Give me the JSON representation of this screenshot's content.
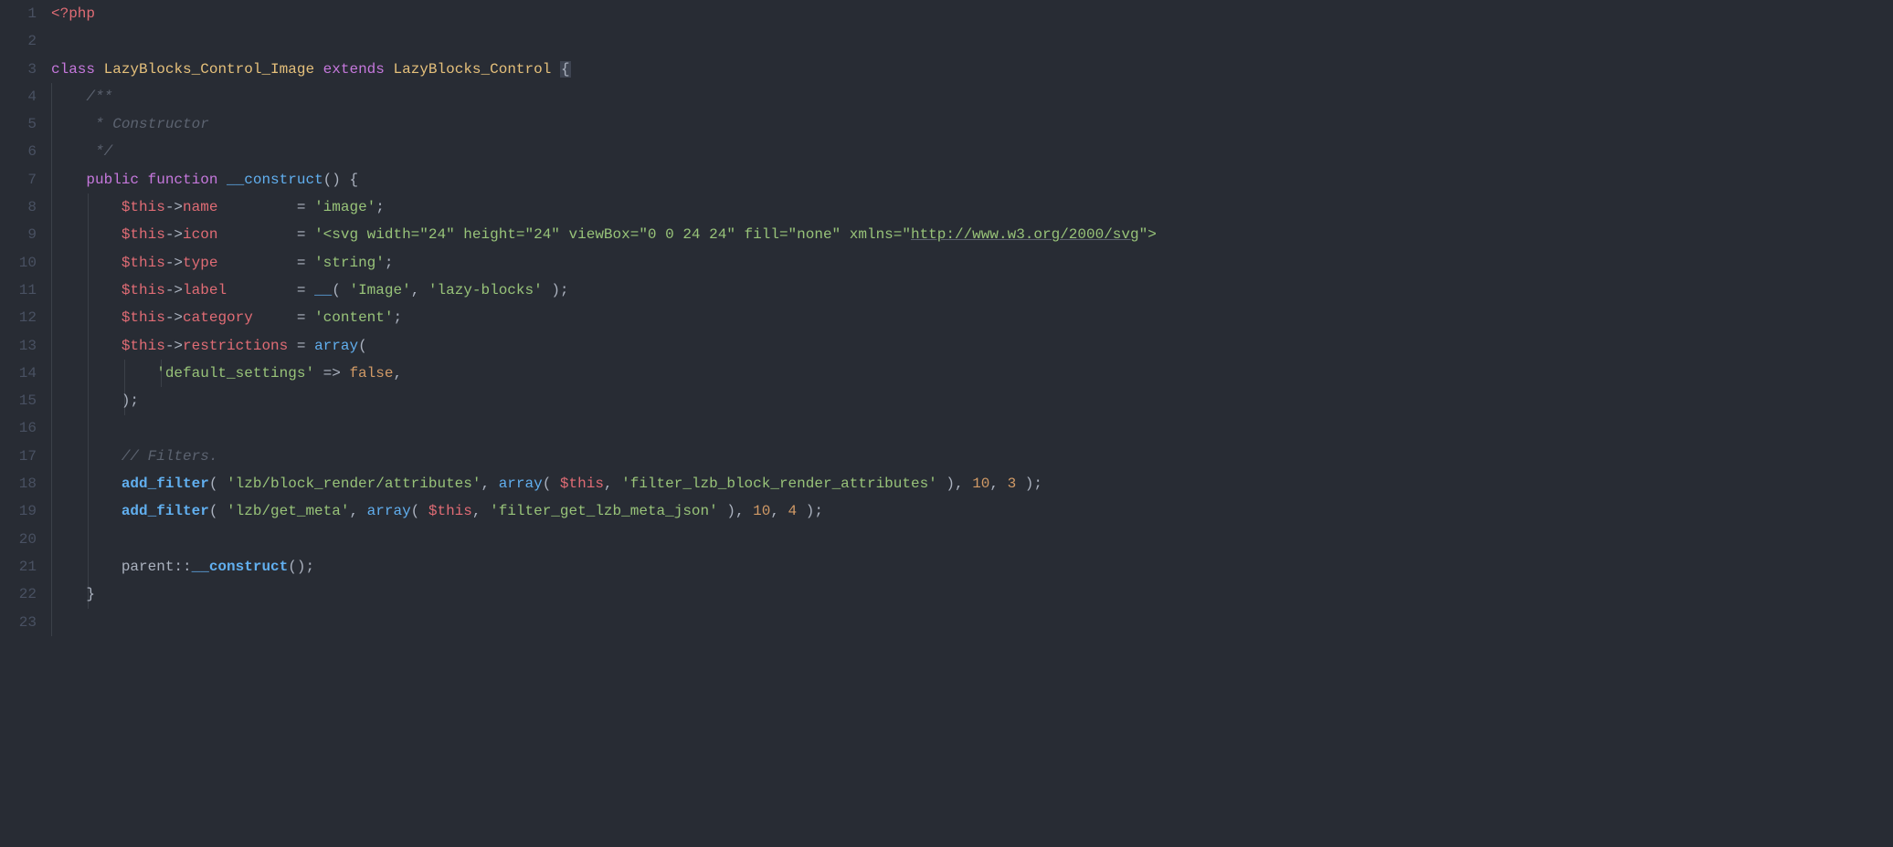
{
  "gutter": [
    "1",
    "2",
    "3",
    "4",
    "5",
    "6",
    "7",
    "8",
    "9",
    "10",
    "11",
    "12",
    "13",
    "14",
    "15",
    "16",
    "17",
    "18",
    "19",
    "20",
    "21",
    "22",
    "23"
  ],
  "code": {
    "l1": {
      "php_open": "<?php"
    },
    "l3": {
      "class_kw": "class",
      "class_name": "LazyBlocks_Control_Image",
      "extends_kw": "extends",
      "parent_class": "LazyBlocks_Control",
      "brace": "{"
    },
    "l4": {
      "doc": "/**"
    },
    "l5": {
      "doc": " * Constructor"
    },
    "l6": {
      "doc": " */"
    },
    "l7": {
      "public_kw": "public",
      "function_kw": "function",
      "func_name": "__construct",
      "parens": "()",
      "brace": "{"
    },
    "l8": {
      "this": "$this",
      "arrow": "->",
      "prop": "name",
      "pad": "         ",
      "eq": "= ",
      "val": "'image'",
      "semi": ";"
    },
    "l9": {
      "this": "$this",
      "arrow": "->",
      "prop": "icon",
      "pad": "         ",
      "eq": "= ",
      "val_pre": "'<svg width=\"24\" height=\"24\" viewBox=\"0 0 24 24\" fill=\"none\" xmlns=\"",
      "val_link": "http://www.w3.org/2000/svg",
      "val_post": "\">"
    },
    "l10": {
      "this": "$this",
      "arrow": "->",
      "prop": "type",
      "pad": "         ",
      "eq": "= ",
      "val": "'string'",
      "semi": ";"
    },
    "l11": {
      "this": "$this",
      "arrow": "->",
      "prop": "label",
      "pad": "        ",
      "eq": "= ",
      "func": "__",
      "open": "( ",
      "arg1": "'Image'",
      "comma": ", ",
      "arg2": "'lazy-blocks'",
      "close": " )",
      "semi": ";"
    },
    "l12": {
      "this": "$this",
      "arrow": "->",
      "prop": "category",
      "pad": "     ",
      "eq": "= ",
      "val": "'content'",
      "semi": ";"
    },
    "l13": {
      "this": "$this",
      "arrow": "->",
      "prop": "restrictions",
      "pad": " ",
      "eq": "= ",
      "func": "array",
      "open": "("
    },
    "l14": {
      "key": "'default_settings'",
      "arrow": " => ",
      "val": "false",
      "comma": ","
    },
    "l15": {
      "close": ")",
      "semi": ";"
    },
    "l17": {
      "comment": "// Filters."
    },
    "l18": {
      "func": "add_filter",
      "open": "( ",
      "arg1": "'lzb/block_render/attributes'",
      "comma1": ", ",
      "array_func": "array",
      "ar_open": "( ",
      "this": "$this",
      "comma2": ", ",
      "arg2": "'filter_lzb_block_render_attributes'",
      "ar_close": " )",
      "comma3": ", ",
      "num1": "10",
      "comma4": ", ",
      "num2": "3",
      "close": " )",
      "semi": ";"
    },
    "l19": {
      "func": "add_filter",
      "open": "( ",
      "arg1": "'lzb/get_meta'",
      "comma1": ", ",
      "array_func": "array",
      "ar_open": "( ",
      "this": "$this",
      "comma2": ", ",
      "arg2": "'filter_get_lzb_meta_json'",
      "ar_close": " )",
      "comma3": ", ",
      "num1": "10",
      "comma4": ", ",
      "num2": "4",
      "close": " )",
      "semi": ";"
    },
    "l21": {
      "parent": "parent",
      "dcolon": "::",
      "func": "__construct",
      "parens": "()",
      "semi": ";"
    },
    "l22": {
      "brace": "}"
    }
  }
}
